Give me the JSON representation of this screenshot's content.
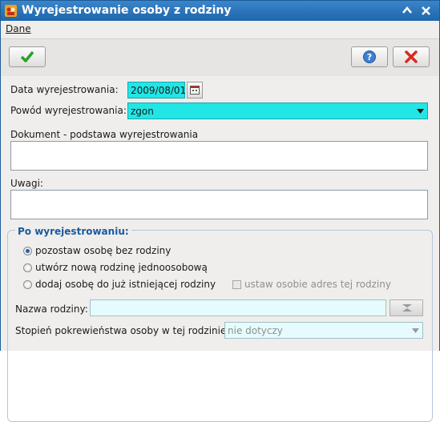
{
  "window": {
    "title": "Wyrejestrowanie osoby z rodziny",
    "accent": "#1e66ad",
    "controls": {
      "minimize_glyph": "⌃",
      "close_glyph": "✕"
    }
  },
  "menu": {
    "items": [
      {
        "label": "Dane"
      }
    ]
  },
  "toolbar": {
    "save_icon": "check-icon",
    "help_icon": "question-icon",
    "cancel_icon": "x-icon"
  },
  "form": {
    "date": {
      "label": "Data wyrejestrowania:",
      "value": "2009/08/01",
      "calendar_icon": "calendar-icon"
    },
    "reason": {
      "label": "Powód wyrejestrowania:",
      "value": "zgon"
    },
    "document": {
      "label": "Dokument - podstawa wyrejestrowania",
      "value": ""
    },
    "notes": {
      "label": "Uwagi:",
      "value": ""
    }
  },
  "after": {
    "title": "Po wyrejestrowaniu:",
    "options": [
      {
        "label": "pozostaw osobę bez rodziny",
        "selected": true
      },
      {
        "label": "utwórz nową rodzinę jednoosobową",
        "selected": false
      },
      {
        "label": "dodaj osobę do już istniejącej rodziny",
        "selected": false
      }
    ],
    "address_checkbox": {
      "label": "ustaw osobie adres tej rodziny",
      "checked": false,
      "enabled": false
    },
    "family_name": {
      "label": "Nazwa rodziny:",
      "value": ""
    },
    "relationship": {
      "label": "Stopień pokrewieństwa osoby w tej rodzinie:",
      "value": "nie dotyczy"
    }
  }
}
